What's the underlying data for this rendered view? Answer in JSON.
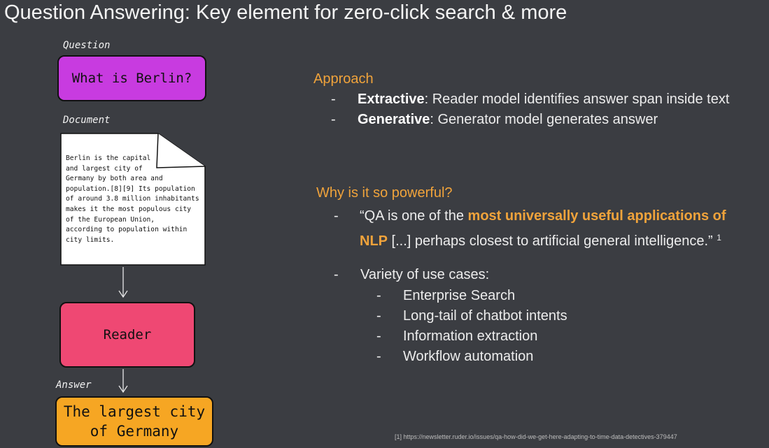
{
  "title": "Question Answering: Key element for zero-click search & more",
  "diagram": {
    "question_label": "Question",
    "question_text": "What is Berlin?",
    "document_label": "Document",
    "document_text": "Berlin is the capital\nand largest city of\nGermany by both area and\npopulation.[8][9] Its population\nof around 3.8 million inhabitants\nmakes it the most populous city\nof the European Union,\naccording to population within\ncity limits.",
    "reader_text": "Reader",
    "answer_label": "Answer",
    "answer_line1": "The largest city",
    "answer_line2": "of Germany",
    "colors": {
      "question": "#c83be0",
      "reader": "#ef4873",
      "answer": "#f6a623",
      "document": "#ffffff"
    }
  },
  "approach": {
    "heading": "Approach",
    "items": [
      {
        "bold": "Extractive",
        "rest": ": Reader model identifies answer span inside text"
      },
      {
        "bold": "Generative",
        "rest": ": Generator model generates answer"
      }
    ]
  },
  "powerful": {
    "heading": "Why is it so powerful?",
    "quote_pre": "“QA is one of the ",
    "quote_hl1": "most universally useful applications of",
    "quote_hl2": "NLP",
    "quote_post": " [...] perhaps closest to artificial general intelligence.”",
    "footnote_ref": "1",
    "variety_label": "Variety of use cases:",
    "use_cases": [
      "Enterprise Search",
      "Long-tail of chatbot intents",
      "Information extraction",
      "Workflow automation"
    ]
  },
  "footnote": "[1] https://newsletter.ruder.io/issues/qa-how-did-we-get-here-adapting-to-time-data-detectives-379447",
  "dash": "-"
}
